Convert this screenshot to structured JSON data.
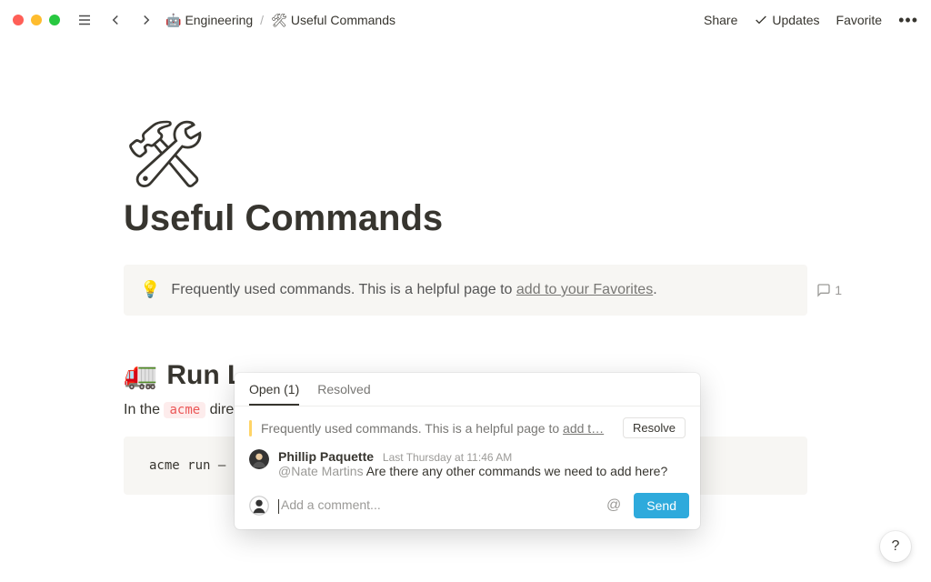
{
  "breadcrumb": {
    "parent_icon": "🤖",
    "parent_label": "Engineering",
    "page_icon": "🛠",
    "page_label": "Useful Commands"
  },
  "topbar": {
    "share": "Share",
    "updates": "Updates",
    "favorite": "Favorite"
  },
  "page": {
    "emoji": "🛠",
    "title": "Useful Commands"
  },
  "callout": {
    "icon": "💡",
    "text_prefix": "Frequently used commands. This is a helpful page to ",
    "link_text": "add to your Favorites",
    "text_suffix": ".",
    "comment_count": "1"
  },
  "section": {
    "emoji": "🚛",
    "heading": "Run L",
    "body_prefix": "In the ",
    "body_code": "acme",
    "body_suffix": " dire",
    "code": "acme run —"
  },
  "popover": {
    "tabs": {
      "open": "Open (1)",
      "resolved": "Resolved"
    },
    "quote_prefix": "Frequently used commands. This is a helpful page to ",
    "quote_link": "add t…",
    "resolve_label": "Resolve",
    "author": "Phillip Paquette",
    "timestamp": "Last Thursday at 11:46 AM",
    "mention": "@Nate Martins",
    "comment_text": " Are there any other commands we need to add here?",
    "composer_placeholder": "Add a comment...",
    "send_label": "Send"
  },
  "help": {
    "label": "?"
  }
}
